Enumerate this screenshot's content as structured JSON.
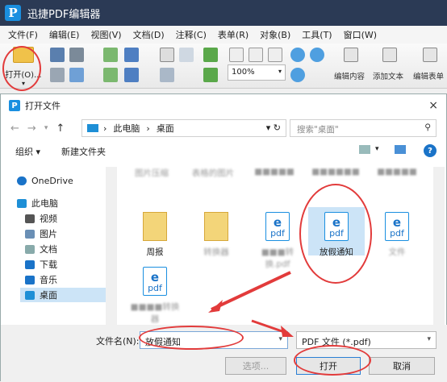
{
  "app": {
    "title": "迅捷PDF编辑器",
    "logo_letter": "P"
  },
  "menu": [
    "文件(F)",
    "编辑(E)",
    "视图(V)",
    "文档(D)",
    "注释(C)",
    "表单(R)",
    "对象(B)",
    "工具(T)",
    "窗口(W)"
  ],
  "toolbar": {
    "open_label": "打开(O)...",
    "zoom_value": "100%",
    "edit_content": "编辑内容",
    "add_text": "添加文本",
    "edit_form": "编辑表单"
  },
  "dialog": {
    "title": "打开文件",
    "close": "×",
    "breadcrumb": [
      "此电脑",
      "桌面"
    ],
    "search_placeholder": "搜索\"桌面\"",
    "organize": "组织 ▾",
    "new_folder": "新建文件夹",
    "nav": [
      {
        "label": "OneDrive",
        "icon": "cloud-icon",
        "color": "#1a73c8"
      },
      {
        "label": "此电脑",
        "icon": "pc-icon",
        "color": "#1e8fd6"
      },
      {
        "label": "视频",
        "icon": "video-icon",
        "color": "#555"
      },
      {
        "label": "图片",
        "icon": "pictures-icon",
        "color": "#6a8fb5"
      },
      {
        "label": "文档",
        "icon": "documents-icon",
        "color": "#8aa"
      },
      {
        "label": "下载",
        "icon": "download-icon",
        "color": "#1a73c8"
      },
      {
        "label": "音乐",
        "icon": "music-icon",
        "color": "#1a73c8"
      },
      {
        "label": "桌面",
        "icon": "desktop-icon",
        "color": "#1e8fd6"
      }
    ],
    "files_row0": [
      "图片压缩",
      "表格的图片",
      "■■■■■",
      "■■■■■■",
      "■■■■■"
    ],
    "files": [
      {
        "name": "周报",
        "type": "doc"
      },
      {
        "name": "转换器",
        "type": "doc"
      },
      {
        "name": "■■■转换.pdf",
        "type": "pdf"
      },
      {
        "name": "放假通知",
        "type": "pdf"
      },
      {
        "name": "文件",
        "type": "pdf"
      },
      {
        "name": "■■■■转换器",
        "type": "pdf"
      }
    ],
    "filename_label": "文件名(N):",
    "filename_value": "放假通知",
    "filetype_value": "PDF 文件 (*.pdf)",
    "options_btn": "选项...",
    "open_btn": "打开",
    "cancel_btn": "取消"
  },
  "colors": {
    "accent": "#1a8fe0",
    "annotation": "#e23b3b",
    "titlebar": "#2b3a55"
  }
}
